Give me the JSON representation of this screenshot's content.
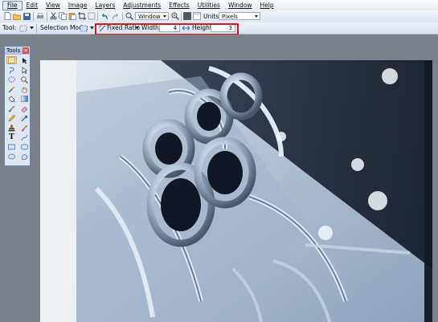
{
  "menu": {
    "items": [
      "File",
      "Edit",
      "View",
      "Image",
      "Layers",
      "Adjustments",
      "Effects",
      "Utilities",
      "Window",
      "Help"
    ],
    "active": "File"
  },
  "toolbar": {
    "zoom_select": "Window",
    "units_label": "Units:",
    "units_select": "Pixels"
  },
  "options": {
    "tool_label": "Tool:",
    "selection_mode_label": "Selection Mode:",
    "ratio_select": "Fixed Ratio",
    "width_label": "Width:",
    "width_value": "4",
    "height_label": "Height:",
    "height_value": "3"
  },
  "tools_window": {
    "title": "Tools",
    "close": "×",
    "text_tool_glyph": "T"
  },
  "colors": {
    "highlight": "#e0141b",
    "accent": "#3b6bb5"
  }
}
